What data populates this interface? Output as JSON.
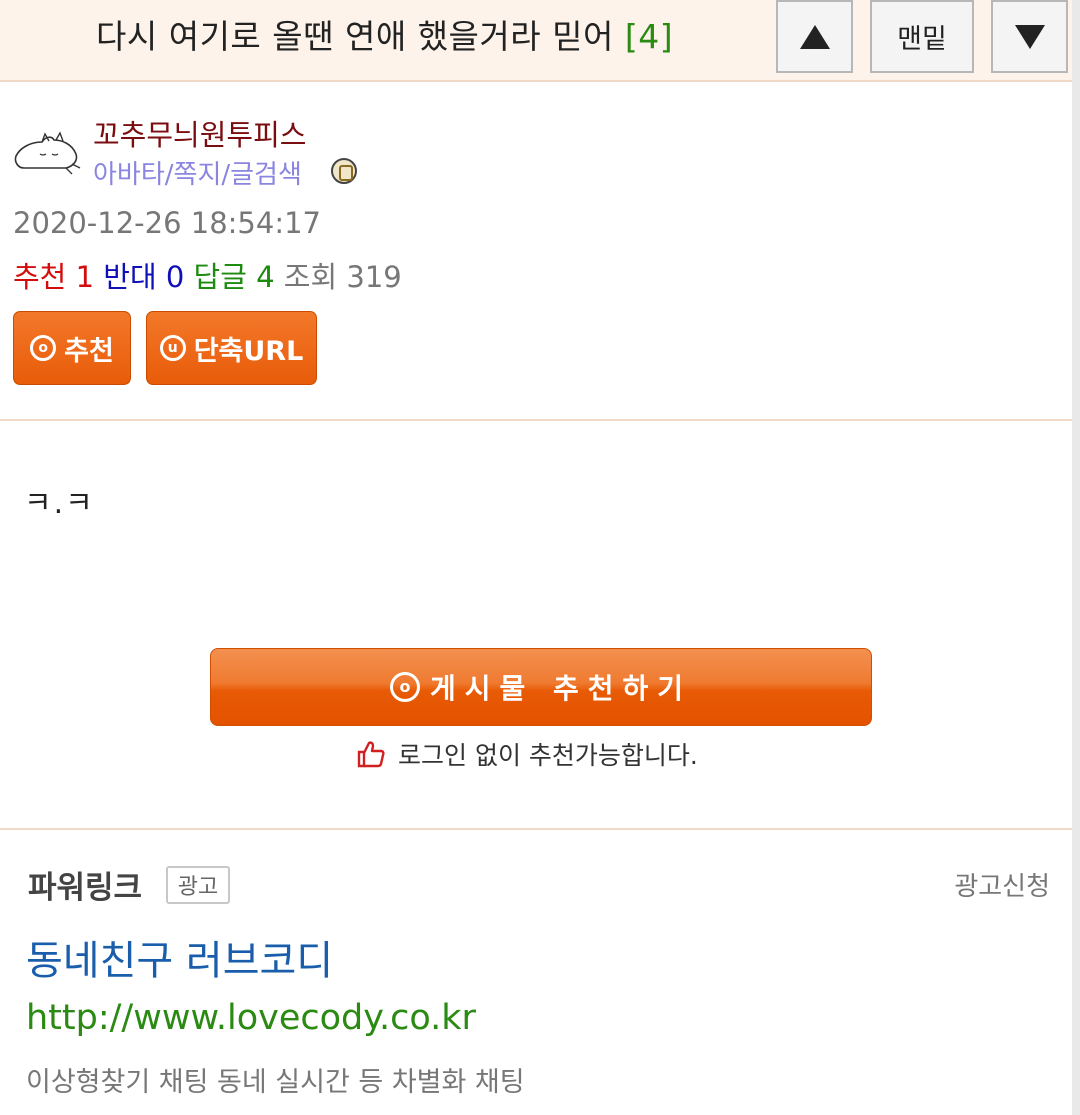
{
  "topbar": {
    "title": "다시 여기로 올땐 연애 했을거라 믿어",
    "comment_count": "[4]",
    "bottom_label": "맨밑"
  },
  "author": {
    "name": "꼬추무늬원투피스",
    "links": "아바타/쪽지/글검색",
    "avatar_icon": "sleeping-cat-icon",
    "badge_icon": "level-badge-icon"
  },
  "post": {
    "date": "2020-12-26 18:54:17",
    "stats": {
      "recommend_label": "추천",
      "recommend_value": "1",
      "oppose_label": "반대",
      "oppose_value": "0",
      "reply_label": "답글",
      "reply_value": "4",
      "view_label": "조회",
      "view_value": "319"
    },
    "buttons": {
      "recommend": "추천",
      "short_url": "단축URL"
    },
    "body": "ㅋ.ㅋ",
    "recommend_big": "게시물 추천하기",
    "note": "로그인 없이 추천가능합니다."
  },
  "ad": {
    "section_title": "파워링크",
    "badge": "광고",
    "apply": "광고신청",
    "title": "동네친구 러브코디",
    "url": "http://www.lovecody.co.kr",
    "desc": "이상형찾기 채팅 동네 실시간 등 차별화 채팅"
  },
  "colors": {
    "accent_orange": "#e85c09",
    "author_name": "#7a0d10",
    "link_blue": "#1a5eab",
    "url_green": "#2a8a12"
  }
}
